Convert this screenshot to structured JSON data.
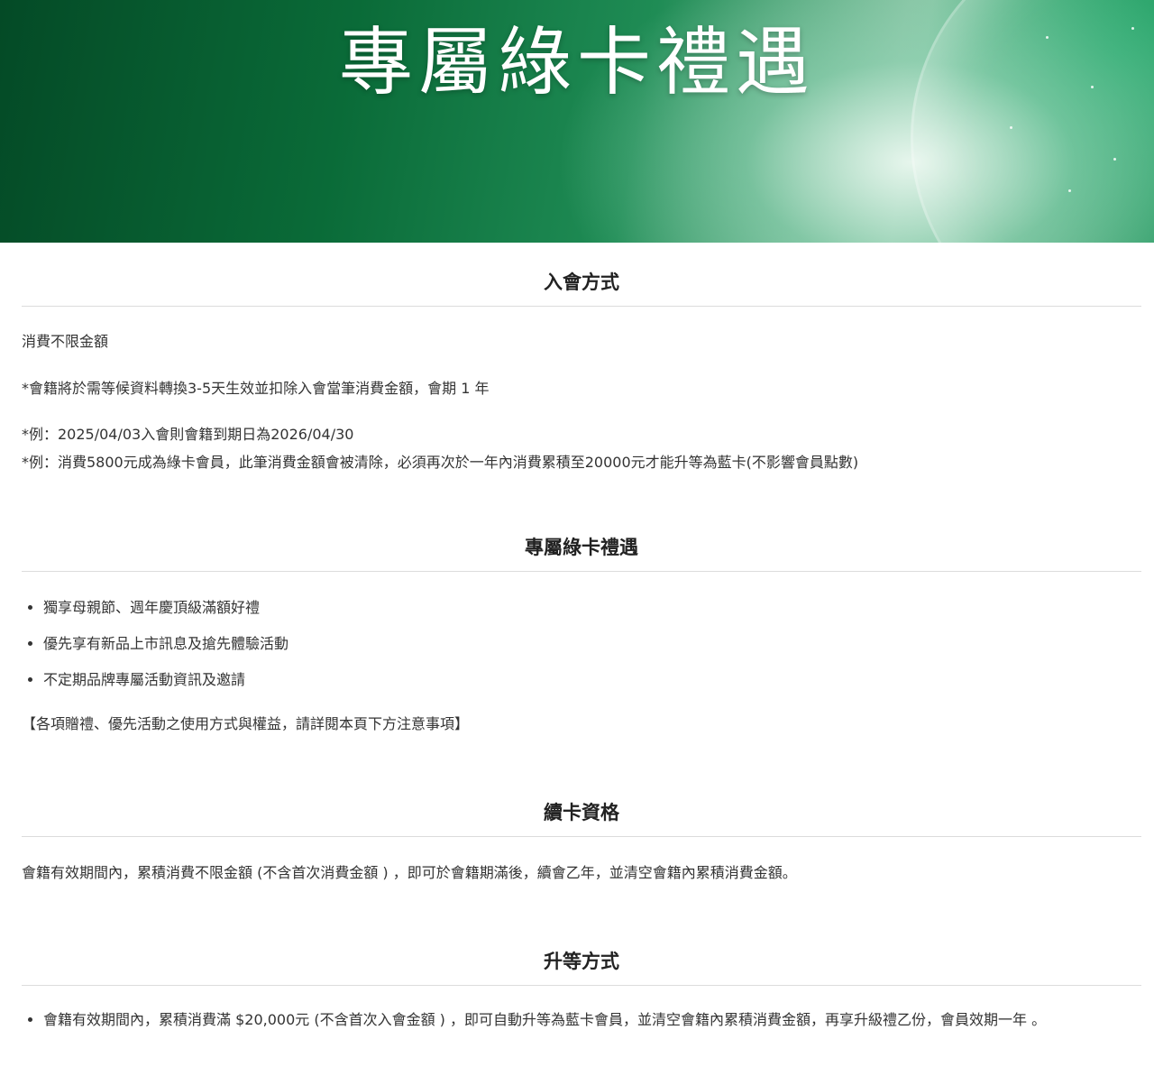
{
  "banner": {
    "title": "專屬綠卡禮遇"
  },
  "sections": {
    "join": {
      "title": "入會方式",
      "p1": "消費不限金額",
      "p2": "*會籍將於需等候資料轉換3-5天生效並扣除入會當筆消費金額，會期 1 年",
      "p3": "*例：2025/04/03入會則會籍到期日為2026/04/30",
      "p4": "*例：消費5800元成為綠卡會員，此筆消費金額會被清除，必須再次於一年內消費累積至20000元才能升等為藍卡(不影響會員點數)"
    },
    "benefits": {
      "title": "專屬綠卡禮遇",
      "items": [
        "獨享母親節、週年慶頂級滿額好禮",
        "優先享有新品上市訊息及搶先體驗活動",
        "不定期品牌專屬活動資訊及邀請"
      ],
      "note": "【各項贈禮、優先活動之使用方式與權益，請詳閱本頁下方注意事項】"
    },
    "renewal": {
      "title": "續卡資格",
      "p1": "會籍有效期間內，累積消費不限金額 (不含首次消費金額 ) ，即可於會籍期滿後，續會乙年，並清空會籍內累積消費金額。"
    },
    "upgrade": {
      "title": "升等方式",
      "items": [
        "會籍有效期間內，累積消費滿 $20,000元 (不含首次入會金額 ) ，即可自動升等為藍卡會員，並清空會籍內累積消費金額，再享升級禮乙份，會員效期一年 。"
      ]
    }
  },
  "colors": {
    "banner_dark": "#044a26",
    "banner_mid": "#1f8c55",
    "text": "#333333",
    "divider": "#dcdcdc"
  }
}
